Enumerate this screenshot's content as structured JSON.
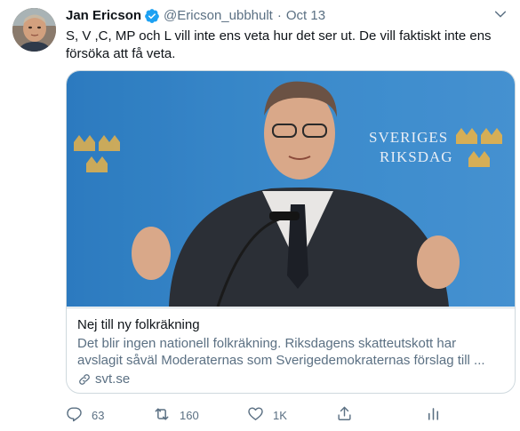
{
  "tweet": {
    "author_name": "Jan Ericson",
    "handle": "@Ericson_ubbhult",
    "separator": "·",
    "date": "Oct 13",
    "text": "S, V ,C, MP och L vill inte ens veta hur det ser ut. De vill faktiskt inte ens försöka att få veta."
  },
  "card": {
    "image_sign_line1": "SVERIGES",
    "image_sign_line2": "RIKSDAG",
    "title": "Nej till ny folkräkning",
    "description": "Det blir ingen nationell folkräkning. Riksdagens skatteutskott har avslagit såväl Moderaternas som Sverigedemokraternas förslag till ...",
    "domain": "svt.se"
  },
  "actions": {
    "reply_count": "63",
    "retweet_count": "160",
    "like_count": "1K"
  },
  "colors": {
    "text": "#0f1419",
    "secondary": "#5b7083",
    "verified": "#1da1f2",
    "border": "#cfd9de"
  },
  "icons": [
    "verified-badge-icon",
    "chevron-down-icon",
    "link-icon",
    "reply-icon",
    "retweet-icon",
    "like-icon",
    "share-icon",
    "analytics-icon"
  ]
}
